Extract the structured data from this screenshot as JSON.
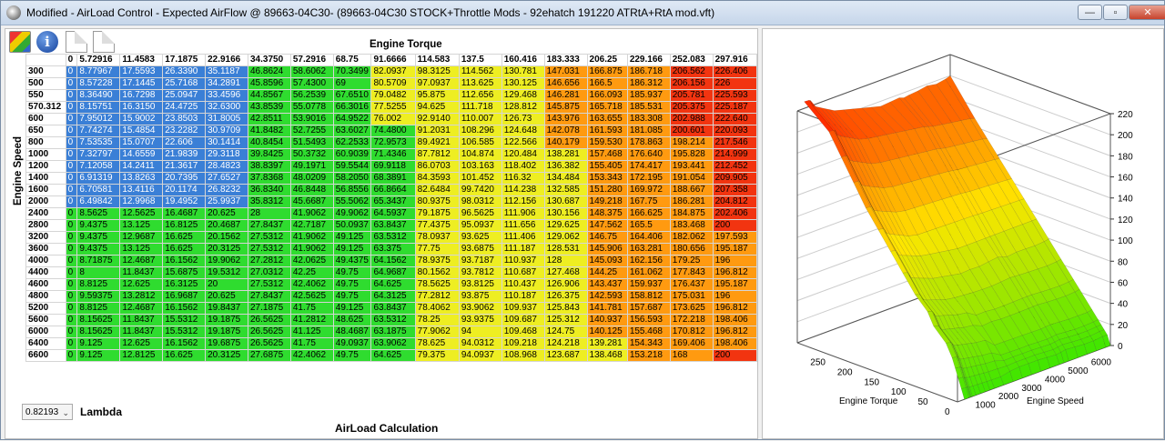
{
  "window": {
    "title": "Modified - AirLoad Control - Expected AirFlow @ 89663-04C30- (89663-04C30 STOCK+Throttle Mods - 92ehatch 191220 ATRtA+RtA mod.vft)",
    "minimize": "—",
    "maximize": "▫",
    "close": "✕"
  },
  "toolbar": {
    "info_glyph": "i"
  },
  "table": {
    "column_axis": "Engine Torque",
    "row_axis": "Engine Speed",
    "columns": [
      "0",
      "5.72916",
      "11.4583",
      "17.1875",
      "22.9166",
      "34.3750",
      "57.2916",
      "68.75",
      "91.6666",
      "114.583",
      "137.5",
      "160.416",
      "183.333",
      "206.25",
      "229.166",
      "252.083",
      "297.916"
    ],
    "rows": [
      {
        "label": "300",
        "values": [
          "0",
          "8.77967",
          "17.5593",
          "26.3390",
          "35.1187",
          "46.8624",
          "58.6062",
          "70.3499",
          "82.0937",
          "98.3125",
          "114.562",
          "130.781",
          "147.031",
          "166.875",
          "186.718",
          "206.562",
          "226.406"
        ]
      },
      {
        "label": "500",
        "values": [
          "0",
          "8.57228",
          "17.1445",
          "25.7168",
          "34.2891",
          "45.8596",
          "57.4300",
          "69",
          "80.5709",
          "97.0937",
          "113.625",
          "130.125",
          "146.656",
          "166.5",
          "186.312",
          "206.156",
          "226"
        ]
      },
      {
        "label": "550",
        "values": [
          "0",
          "8.36490",
          "16.7298",
          "25.0947",
          "33.4596",
          "44.8567",
          "56.2539",
          "67.6510",
          "79.0482",
          "95.875",
          "112.656",
          "129.468",
          "146.281",
          "166.093",
          "185.937",
          "205.781",
          "225.593"
        ]
      },
      {
        "label": "570.312",
        "values": [
          "0",
          "8.15751",
          "16.3150",
          "24.4725",
          "32.6300",
          "43.8539",
          "55.0778",
          "66.3016",
          "77.5255",
          "94.625",
          "111.718",
          "128.812",
          "145.875",
          "165.718",
          "185.531",
          "205.375",
          "225.187"
        ]
      },
      {
        "label": "600",
        "values": [
          "0",
          "7.95012",
          "15.9002",
          "23.8503",
          "31.8005",
          "42.8511",
          "53.9016",
          "64.9522",
          "76.002",
          "92.9140",
          "110.007",
          "126.73",
          "143.976",
          "163.655",
          "183.308",
          "202.988",
          "222.640"
        ]
      },
      {
        "label": "650",
        "values": [
          "0",
          "7.74274",
          "15.4854",
          "23.2282",
          "30.9709",
          "41.8482",
          "52.7255",
          "63.6027",
          "74.4800",
          "91.2031",
          "108.296",
          "124.648",
          "142.078",
          "161.593",
          "181.085",
          "200.601",
          "220.093"
        ]
      },
      {
        "label": "800",
        "values": [
          "0",
          "7.53535",
          "15.0707",
          "22.606",
          "30.1414",
          "40.8454",
          "51.5493",
          "62.2533",
          "72.9573",
          "89.4921",
          "106.585",
          "122.566",
          "140.179",
          "159.530",
          "178.863",
          "198.214",
          "217.546"
        ]
      },
      {
        "label": "1000",
        "values": [
          "0",
          "7.32797",
          "14.6559",
          "21.9839",
          "29.3118",
          "39.8425",
          "50.3732",
          "60.9039",
          "71.4346",
          "87.7812",
          "104.874",
          "120.484",
          "138.281",
          "157.468",
          "176.640",
          "195.828",
          "214.999"
        ]
      },
      {
        "label": "1200",
        "values": [
          "0",
          "7.12058",
          "14.2411",
          "21.3617",
          "28.4823",
          "38.8397",
          "49.1971",
          "59.5544",
          "69.9118",
          "86.0703",
          "103.163",
          "118.402",
          "136.382",
          "155.405",
          "174.417",
          "193.441",
          "212.452"
        ]
      },
      {
        "label": "1400",
        "values": [
          "0",
          "6.91319",
          "13.8263",
          "20.7395",
          "27.6527",
          "37.8368",
          "48.0209",
          "58.2050",
          "68.3891",
          "84.3593",
          "101.452",
          "116.32",
          "134.484",
          "153.343",
          "172.195",
          "191.054",
          "209.905"
        ]
      },
      {
        "label": "1600",
        "values": [
          "0",
          "6.70581",
          "13.4116",
          "20.1174",
          "26.8232",
          "36.8340",
          "46.8448",
          "56.8556",
          "66.8664",
          "82.6484",
          "99.7420",
          "114.238",
          "132.585",
          "151.280",
          "169.972",
          "188.667",
          "207.358"
        ]
      },
      {
        "label": "2000",
        "values": [
          "0",
          "6.49842",
          "12.9968",
          "19.4952",
          "25.9937",
          "35.8312",
          "45.6687",
          "55.5062",
          "65.3437",
          "80.9375",
          "98.0312",
          "112.156",
          "130.687",
          "149.218",
          "167.75",
          "186.281",
          "204.812"
        ]
      },
      {
        "label": "2400",
        "values": [
          "0",
          "8.5625",
          "12.5625",
          "16.4687",
          "20.625",
          "28",
          "41.9062",
          "49.9062",
          "64.5937",
          "79.1875",
          "96.5625",
          "111.906",
          "130.156",
          "148.375",
          "166.625",
          "184.875",
          "202.406"
        ]
      },
      {
        "label": "2800",
        "values": [
          "0",
          "9.4375",
          "13.125",
          "16.8125",
          "20.4687",
          "27.8437",
          "42.7187",
          "50.0937",
          "63.8437",
          "77.4375",
          "95.0937",
          "111.656",
          "129.625",
          "147.562",
          "165.5",
          "183.468",
          "200"
        ]
      },
      {
        "label": "3200",
        "values": [
          "0",
          "9.4375",
          "12.9687",
          "16.625",
          "20.1562",
          "27.5312",
          "41.9062",
          "49.125",
          "63.5312",
          "78.0937",
          "93.625",
          "111.406",
          "129.062",
          "146.75",
          "164.406",
          "182.062",
          "197.593"
        ]
      },
      {
        "label": "3600",
        "values": [
          "0",
          "9.4375",
          "13.125",
          "16.625",
          "20.3125",
          "27.5312",
          "41.9062",
          "49.125",
          "63.375",
          "77.75",
          "93.6875",
          "111.187",
          "128.531",
          "145.906",
          "163.281",
          "180.656",
          "195.187"
        ]
      },
      {
        "label": "4000",
        "values": [
          "0",
          "8.71875",
          "12.4687",
          "16.1562",
          "19.9062",
          "27.2812",
          "42.0625",
          "49.4375",
          "64.1562",
          "78.9375",
          "93.7187",
          "110.937",
          "128",
          "145.093",
          "162.156",
          "179.25",
          "196"
        ]
      },
      {
        "label": "4400",
        "values": [
          "0",
          "8",
          "11.8437",
          "15.6875",
          "19.5312",
          "27.0312",
          "42.25",
          "49.75",
          "64.9687",
          "80.1562",
          "93.7812",
          "110.687",
          "127.468",
          "144.25",
          "161.062",
          "177.843",
          "196.812"
        ]
      },
      {
        "label": "4600",
        "values": [
          "0",
          "8.8125",
          "12.625",
          "16.3125",
          "20",
          "27.5312",
          "42.4062",
          "49.75",
          "64.625",
          "78.5625",
          "93.8125",
          "110.437",
          "126.906",
          "143.437",
          "159.937",
          "176.437",
          "195.187"
        ]
      },
      {
        "label": "4800",
        "values": [
          "0",
          "9.59375",
          "13.2812",
          "16.9687",
          "20.625",
          "27.8437",
          "42.5625",
          "49.75",
          "64.3125",
          "77.2812",
          "93.875",
          "110.187",
          "126.375",
          "142.593",
          "158.812",
          "175.031",
          "196"
        ]
      },
      {
        "label": "5200",
        "values": [
          "0",
          "8.8125",
          "12.4687",
          "16.1562",
          "19.8437",
          "27.1875",
          "41.75",
          "49.125",
          "63.8437",
          "78.4062",
          "93.9062",
          "109.937",
          "125.843",
          "141.781",
          "157.687",
          "173.625",
          "196.812"
        ]
      },
      {
        "label": "5600",
        "values": [
          "0",
          "8.15625",
          "11.8437",
          "15.5312",
          "19.1875",
          "26.5625",
          "41.2812",
          "48.625",
          "63.5312",
          "78.25",
          "93.9375",
          "109.687",
          "125.312",
          "140.937",
          "156.593",
          "172.218",
          "198.406"
        ]
      },
      {
        "label": "6000",
        "values": [
          "0",
          "8.15625",
          "11.8437",
          "15.5312",
          "19.1875",
          "26.5625",
          "41.125",
          "48.4687",
          "63.1875",
          "77.9062",
          "94",
          "109.468",
          "124.75",
          "140.125",
          "155.468",
          "170.812",
          "196.812"
        ]
      },
      {
        "label": "6400",
        "values": [
          "0",
          "9.125",
          "12.625",
          "16.1562",
          "19.6875",
          "26.5625",
          "41.75",
          "49.0937",
          "63.9062",
          "78.625",
          "94.0312",
          "109.218",
          "124.218",
          "139.281",
          "154.343",
          "169.406",
          "198.406"
        ]
      },
      {
        "label": "6600",
        "values": [
          "0",
          "9.125",
          "12.8125",
          "16.625",
          "20.3125",
          "27.6875",
          "42.4062",
          "49.75",
          "64.625",
          "79.375",
          "94.0937",
          "108.968",
          "123.687",
          "138.468",
          "153.218",
          "168",
          "200"
        ]
      }
    ]
  },
  "lambda": {
    "value": "0.82193",
    "label": "Lambda"
  },
  "calc_title": "AirLoad Calculation",
  "plot": {
    "z_ticks": [
      "0",
      "20",
      "40",
      "60",
      "80",
      "100",
      "120",
      "140",
      "160",
      "180",
      "200",
      "220"
    ],
    "torque_ticks": [
      "250",
      "200",
      "150",
      "100",
      "50",
      "0"
    ],
    "speed_ticks": [
      "1000",
      "2000",
      "3000",
      "4000",
      "5000",
      "6000"
    ],
    "torque_label": "Engine Torque",
    "speed_label": "Engine Speed"
  },
  "colors": {
    "blue": "#3a7fd6",
    "green": "#2fdc2f",
    "yellow": "#eeee22",
    "orange": "#ff9a10",
    "red": "#f23410"
  }
}
